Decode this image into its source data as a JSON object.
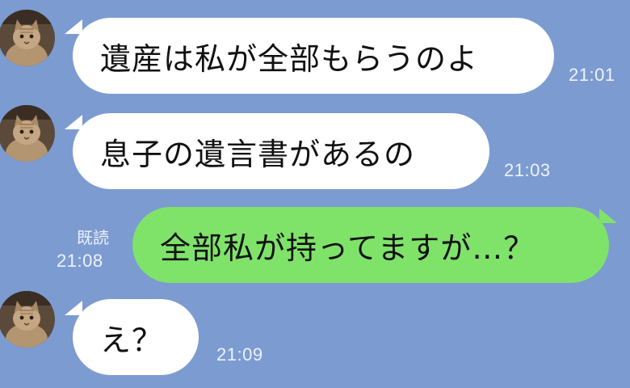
{
  "messages": [
    {
      "sender": "other",
      "text": "遺産は私が全部もらうのよ",
      "time": "21:01"
    },
    {
      "sender": "other",
      "text": "息子の遺言書があるの",
      "time": "21:03"
    },
    {
      "sender": "self",
      "text": "全部私が持ってますが…？",
      "time": "21:08",
      "read": "既読"
    },
    {
      "sender": "other",
      "text": "え？",
      "time": "21:09"
    }
  ],
  "avatar": {
    "icon": "cat-avatar-icon"
  },
  "colors": {
    "background": "#7c9bd1",
    "incoming_bubble": "#ffffff",
    "outgoing_bubble": "#7fe36a"
  }
}
